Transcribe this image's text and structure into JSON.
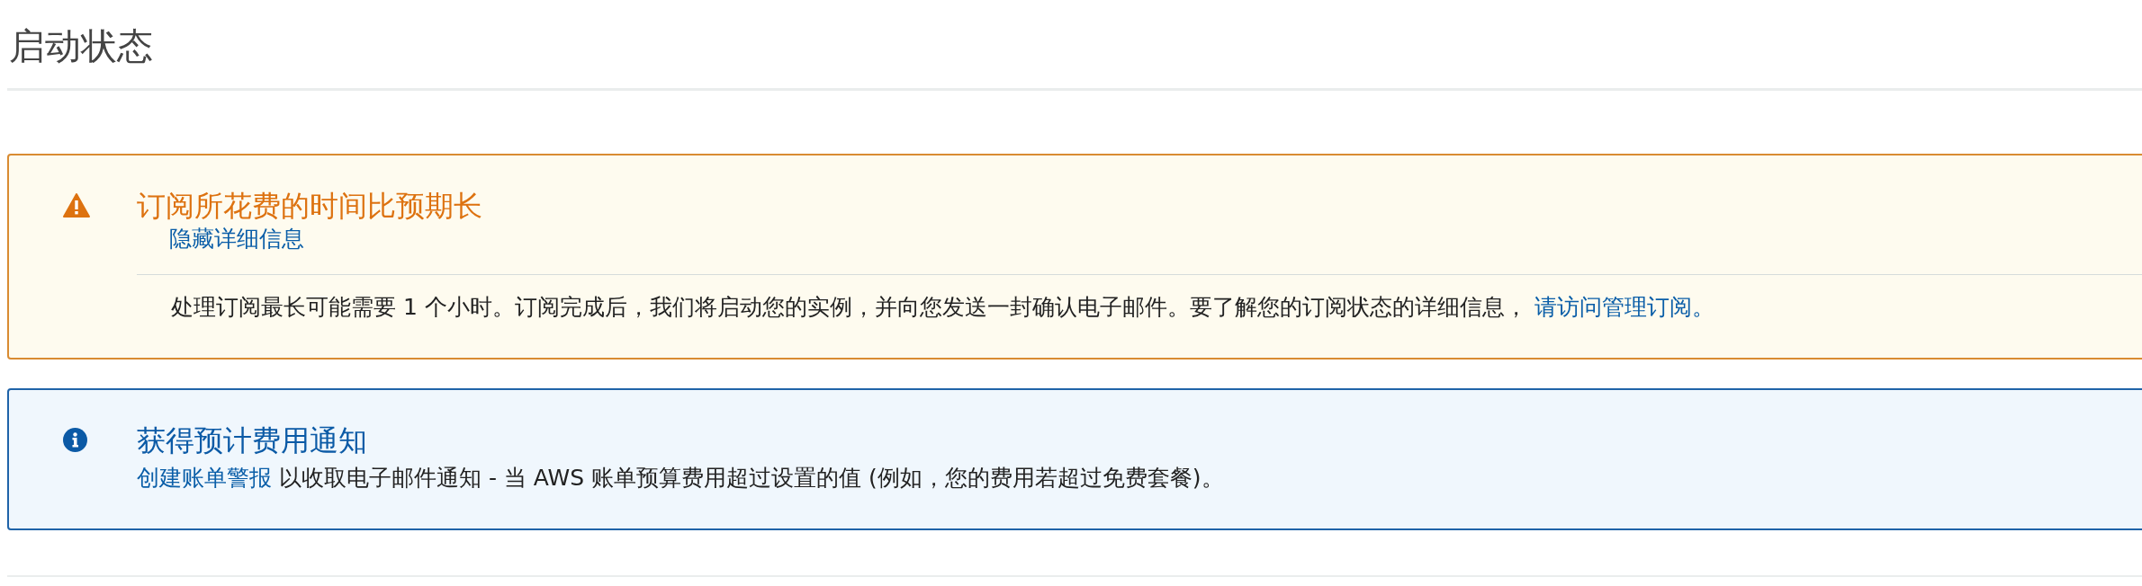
{
  "page": {
    "title": "启动状态"
  },
  "alerts": [
    {
      "kind": "warning",
      "title": "订阅所花费的时间比预期长",
      "toggle_link": "隐藏详细信息",
      "detail_text": "处理订阅最长可能需要 1 个小时。订阅完成后，我们将启动您的实例，并向您发送一封确认电子邮件。要了解您的订阅状态的详细信息， ",
      "detail_link": "请访问管理订阅。"
    },
    {
      "kind": "info",
      "title": "获得预计费用通知",
      "link": "创建账单警报",
      "text": " 以收取电子邮件通知 - 当 AWS 账单预算费用超过设置的值 (例如，您的费用若超过免费套餐)。"
    }
  ]
}
